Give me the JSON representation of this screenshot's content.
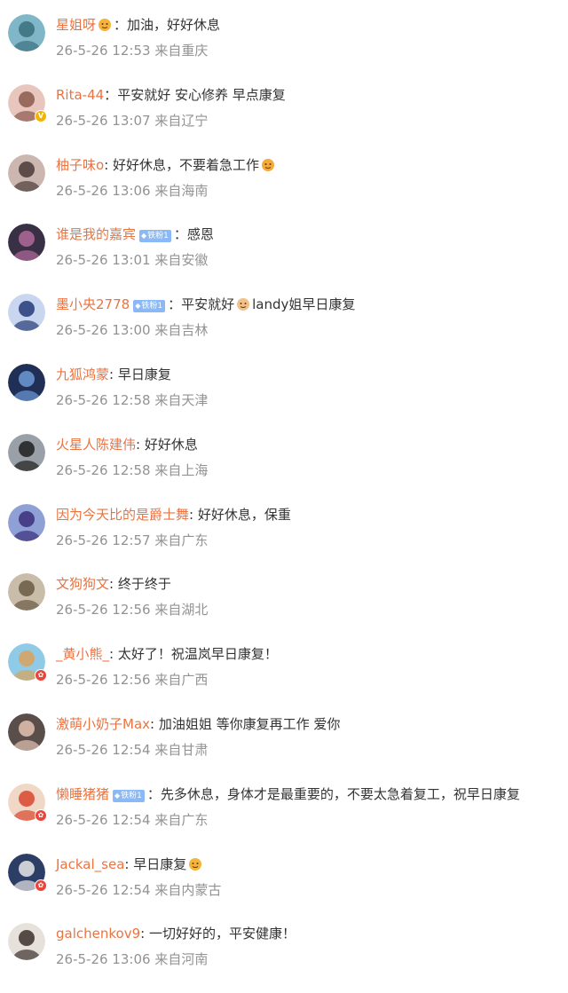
{
  "comments": [
    {
      "user": "星姐呀",
      "sep": "：",
      "text": "加油，好好休息",
      "time": "26-5-26 12:53",
      "loc": "来自重庆",
      "badge": "",
      "emoji_before": "crown-emoji",
      "emoji_after": ""
    },
    {
      "user": "Rita-44",
      "sep": "：",
      "text": "平安就好 安心修养 早点康复",
      "time": "26-5-26 13:07",
      "loc": "来自辽宁",
      "badge": "",
      "emoji_before": "",
      "emoji_after": ""
    },
    {
      "user": "柚子味o",
      "sep": ": ",
      "text": "好好休息，不要着急工作",
      "time": "26-5-26 13:06",
      "loc": "来自海南",
      "badge": "",
      "emoji_before": "",
      "emoji_after": "hug-emoji"
    },
    {
      "user": "谁是我的嘉宾",
      "sep": "：",
      "text": "感恩",
      "time": "26-5-26 13:01",
      "loc": "来自安徽",
      "badge": "铁粉1",
      "emoji_before": "",
      "emoji_after": ""
    },
    {
      "user": "墨小央2778",
      "sep": "：",
      "text": "平安就好",
      "text2": "landy姐早日康复",
      "time": "26-5-26 13:00",
      "loc": "来自吉林",
      "badge": "铁粉1",
      "emoji_before": "",
      "emoji_after": "pray-emoji"
    },
    {
      "user": "九狐鸿蒙",
      "sep": ": ",
      "text": "早日康复",
      "time": "26-5-26 12:58",
      "loc": "来自天津",
      "badge": "",
      "emoji_before": "",
      "emoji_after": ""
    },
    {
      "user": "火星人陈建伟",
      "sep": ": ",
      "text": "好好休息",
      "time": "26-5-26 12:58",
      "loc": "来自上海",
      "badge": "",
      "emoji_before": "",
      "emoji_after": ""
    },
    {
      "user": "因为今天比的是爵士舞",
      "sep": ": ",
      "text": "好好休息，保重",
      "time": "26-5-26 12:57",
      "loc": "来自广东",
      "badge": "",
      "emoji_before": "",
      "emoji_after": ""
    },
    {
      "user": "文狗狗文",
      "sep": ": ",
      "text": "终于终于",
      "time": "26-5-26 12:56",
      "loc": "来自湖北",
      "badge": "",
      "emoji_before": "",
      "emoji_after": ""
    },
    {
      "user": "_黄小熊_",
      "sep": ": ",
      "text": "太好了！祝温岚早日康复！",
      "time": "26-5-26 12:56",
      "loc": "来自广西",
      "badge": "",
      "emoji_before": "",
      "emoji_after": ""
    },
    {
      "user": "激萌小奶子Max",
      "sep": ": ",
      "text": "加油姐姐 等你康复再工作 爱你",
      "time": "26-5-26 12:54",
      "loc": "来自甘肃",
      "badge": "",
      "emoji_before": "",
      "emoji_after": ""
    },
    {
      "user": "懒睡猪猪",
      "sep": "：",
      "text": "先多休息，身体才是最重要的，不要太急着复工，祝早日康复",
      "time": "26-5-26 12:54",
      "loc": "来自广东",
      "badge": "铁粉1",
      "emoji_before": "",
      "emoji_after": ""
    },
    {
      "user": "Jackal_sea",
      "sep": ": ",
      "text": "早日康复",
      "time": "26-5-26 12:54",
      "loc": "来自内蒙古",
      "badge": "",
      "emoji_before": "",
      "emoji_after": "think-emoji"
    },
    {
      "user": "galchenkov9",
      "sep": ": ",
      "text": "一切好好的，平安健康！",
      "time": "26-5-26 13:06",
      "loc": "来自河南",
      "badge": "",
      "emoji_before": "",
      "emoji_after": ""
    }
  ],
  "avatars": [
    {
      "bg": "#7fb7c9",
      "fg": "#3a6f7d",
      "badge": ""
    },
    {
      "bg": "#e8c6bd",
      "fg": "#8a5a4e",
      "badge": "gold"
    },
    {
      "bg": "#cbb7b0",
      "fg": "#4a3a37",
      "badge": ""
    },
    {
      "bg": "#3a3046",
      "fg": "#b06a9a",
      "badge": ""
    },
    {
      "bg": "#c8d6ef",
      "fg": "#243a78",
      "badge": ""
    },
    {
      "bg": "#1f2f55",
      "fg": "#6e9ad6",
      "badge": ""
    },
    {
      "bg": "#9aa0a8",
      "fg": "#1e1e1e",
      "badge": ""
    },
    {
      "bg": "#8fa0d6",
      "fg": "#3b2e7a",
      "badge": ""
    },
    {
      "bg": "#c9bda9",
      "fg": "#6a5a45",
      "badge": ""
    },
    {
      "bg": "#8fcbe6",
      "fg": "#d9a25a",
      "badge": "red"
    },
    {
      "bg": "#5a4e4a",
      "fg": "#e3c3b0",
      "badge": ""
    },
    {
      "bg": "#f0d7c6",
      "fg": "#d8462e",
      "badge": "red"
    },
    {
      "bg": "#2c3e66",
      "fg": "#e8e8e8",
      "badge": "red"
    },
    {
      "bg": "#e7e1dc",
      "fg": "#3b2f2b",
      "badge": ""
    }
  ],
  "badge_glyph": {
    "gold": "V",
    "red": "✿"
  },
  "emojis": {
    "crown-emoji": "#f7b23a",
    "hug-emoji": "#f6a93b",
    "pray-emoji": "#f2c088",
    "think-emoji": "#f5b43a"
  }
}
